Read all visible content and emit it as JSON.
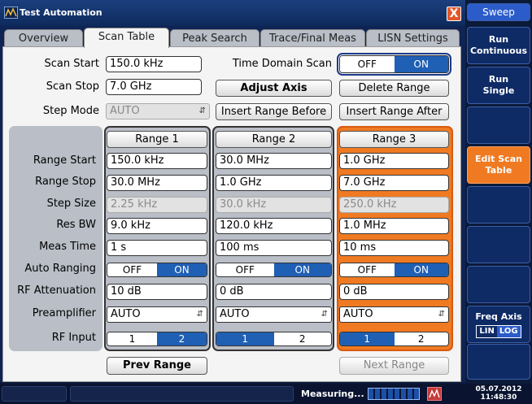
{
  "window": {
    "title": "Test Automation",
    "close_label": "X"
  },
  "tabs": [
    "Overview",
    "Scan Table",
    "Peak Search",
    "Trace/Final Meas",
    "LISN Settings"
  ],
  "scan": {
    "start_label": "Scan Start",
    "start_value": "150.0 kHz",
    "stop_label": "Scan Stop",
    "stop_value": "7.0 GHz",
    "step_mode_label": "Step Mode",
    "step_mode_value": "AUTO",
    "time_domain_label": "Time Domain Scan",
    "td_off": "OFF",
    "td_on": "ON",
    "adjust_axis": "Adjust Axis",
    "delete_range": "Delete Range",
    "insert_before": "Insert Range Before",
    "insert_after": "Insert Range After"
  },
  "row_labels": [
    "Range Start",
    "Range Stop",
    "Step Size",
    "Res BW",
    "Meas Time",
    "Auto Ranging",
    "RF Attenuation",
    "Preamplifier",
    "RF Input"
  ],
  "ranges": [
    {
      "name": "Range 1",
      "start": "150.0 kHz",
      "stop": "30.0 MHz",
      "step": "2.25 kHz",
      "rbw": "9.0 kHz",
      "meas_time": "1 s",
      "auto_off": "OFF",
      "auto_on": "ON",
      "atten": "10 dB",
      "preamp": "AUTO",
      "input1": "1",
      "input2": "2",
      "input_selected": 2
    },
    {
      "name": "Range 2",
      "start": "30.0 MHz",
      "stop": "1.0 GHz",
      "step": "30.0 kHz",
      "rbw": "120.0 kHz",
      "meas_time": "100 ms",
      "auto_off": "OFF",
      "auto_on": "ON",
      "atten": "0 dB",
      "preamp": "AUTO",
      "input1": "1",
      "input2": "2",
      "input_selected": 1
    },
    {
      "name": "Range 3",
      "start": "1.0 GHz",
      "stop": "7.0 GHz",
      "step": "250.0 kHz",
      "rbw": "1.0 MHz",
      "meas_time": "10 ms",
      "auto_off": "OFF",
      "auto_on": "ON",
      "atten": "0 dB",
      "preamp": "AUTO",
      "input1": "1",
      "input2": "2",
      "input_selected": 1
    }
  ],
  "nav": {
    "prev": "Prev Range",
    "next": "Next Range"
  },
  "softkeys": {
    "title": "Sweep",
    "run_cont_1": "Run",
    "run_cont_2": "Continuous",
    "run_single_1": "Run",
    "run_single_2": "Single",
    "edit_1": "Edit Scan",
    "edit_2": "Table",
    "freq_axis": "Freq Axis",
    "lin": "LIN",
    "log": "LOG"
  },
  "status": {
    "measuring": "Measuring...",
    "date": "05.07.2012",
    "time": "11:48:30"
  },
  "colors": {
    "accent": "#f07a22",
    "on_blue": "#1f5fb4",
    "softkey": "#0f2b66"
  }
}
